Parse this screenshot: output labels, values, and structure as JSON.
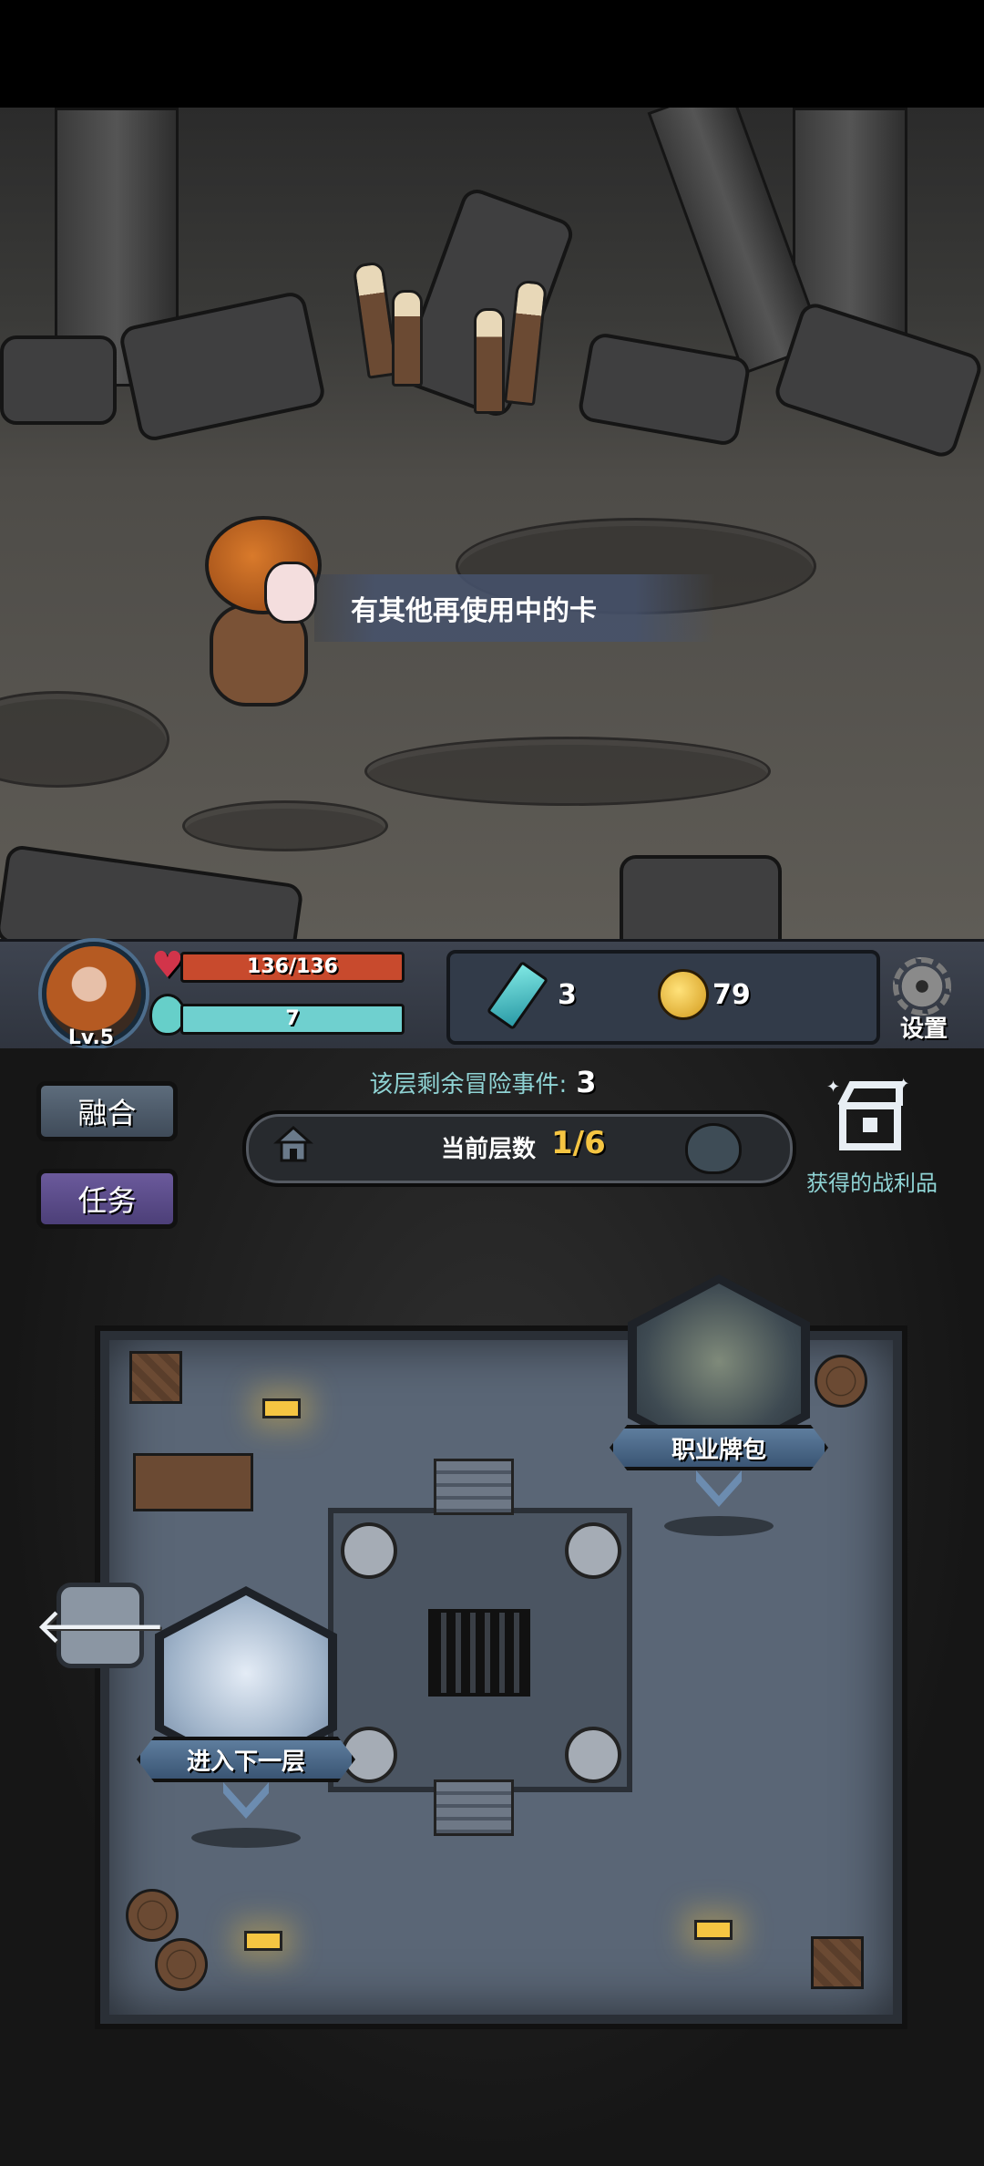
{
  "scene": {
    "dialog": "有其他再使用中的卡"
  },
  "player": {
    "level": "Lv.5",
    "hp": "136/136",
    "mp": "7"
  },
  "currency": {
    "crystals": "3",
    "coins": "79"
  },
  "settings": {
    "label": "设置"
  },
  "sidebar": {
    "fuse_label": "融合",
    "task_label": "任务"
  },
  "floor_info": {
    "events_label": "该层剩余冒险事件:",
    "events_remaining": "3",
    "current_floor_label": "当前层数",
    "current_floor": "1/6"
  },
  "loot": {
    "label": "获得的战利品"
  },
  "map": {
    "job_pack_label": "职业牌包",
    "next_floor_label": "进入下一层"
  },
  "colors": {
    "hp": "#c84a2d",
    "mp": "#6fd0cf",
    "accent_text": "#8fd3d4",
    "floor_value": "#f5c542"
  },
  "icons": [
    "heart-icon",
    "potion-icon",
    "crystal-icon",
    "coin-icon",
    "gear-icon",
    "house-icon",
    "demon-icon",
    "loot-chest-icon",
    "back-arrow-icon"
  ]
}
